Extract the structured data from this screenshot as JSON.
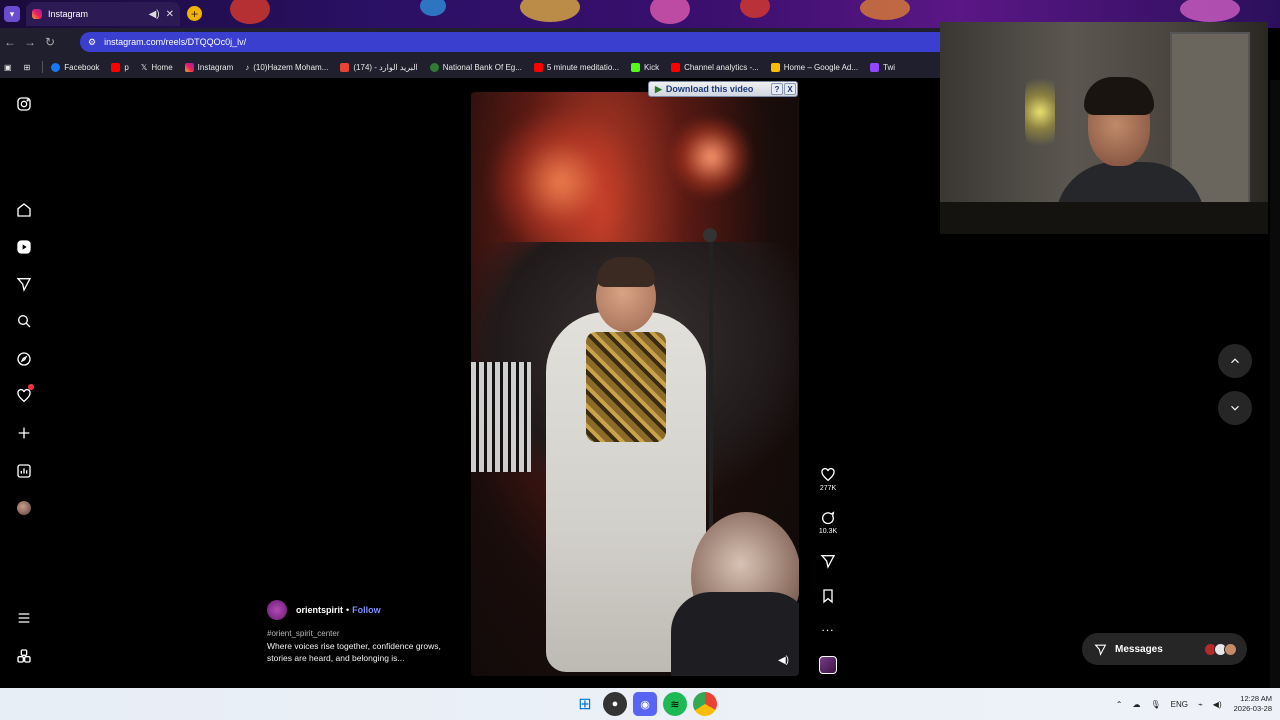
{
  "browser": {
    "tab_title": "Instagram",
    "url": "instagram.com/reels/DTQQOc0j_lv/",
    "bookmarks": [
      {
        "label": "Facebook",
        "color": "#1877f2"
      },
      {
        "label": "p",
        "color": "#ff0000"
      },
      {
        "label": "Home",
        "color": "#ffffff"
      },
      {
        "label": "Instagram",
        "color": "#e1306c"
      },
      {
        "label": "(10)Hazem Moham...",
        "color": "#ffffff"
      },
      {
        "label": "(174) - البريد الوارد",
        "color": "#ea4335"
      },
      {
        "label": "National Bank Of Eg...",
        "color": "#2e7d32"
      },
      {
        "label": "5 minute meditatio...",
        "color": "#ff0000"
      },
      {
        "label": "Kick",
        "color": "#53fc18"
      },
      {
        "label": "Channel analytics -...",
        "color": "#ff0000"
      },
      {
        "label": "Home – Google Ad...",
        "color": "#fbbc04"
      },
      {
        "label": "Twi",
        "color": "#9146ff"
      }
    ]
  },
  "download_banner": {
    "label": "Download this video",
    "help": "?",
    "close": "X"
  },
  "reel": {
    "username": "orientspirit",
    "separator": "•",
    "follow_label": "Follow",
    "hashtag": "#orient_spirit_center",
    "caption": "Where voices rise together, confidence grows, stories are heard, and belonging is...",
    "likes": "277K",
    "comments": "10.3K",
    "more": "..."
  },
  "messages": {
    "label": "Messages"
  },
  "taskbar": {
    "lang": "ENG",
    "time": "12:28 AM",
    "date": "2026-03-28"
  },
  "colors": {
    "follow_link": "#7d8cff",
    "omnibox": "#3b3fd0",
    "notification_dot": "#ff3040"
  }
}
